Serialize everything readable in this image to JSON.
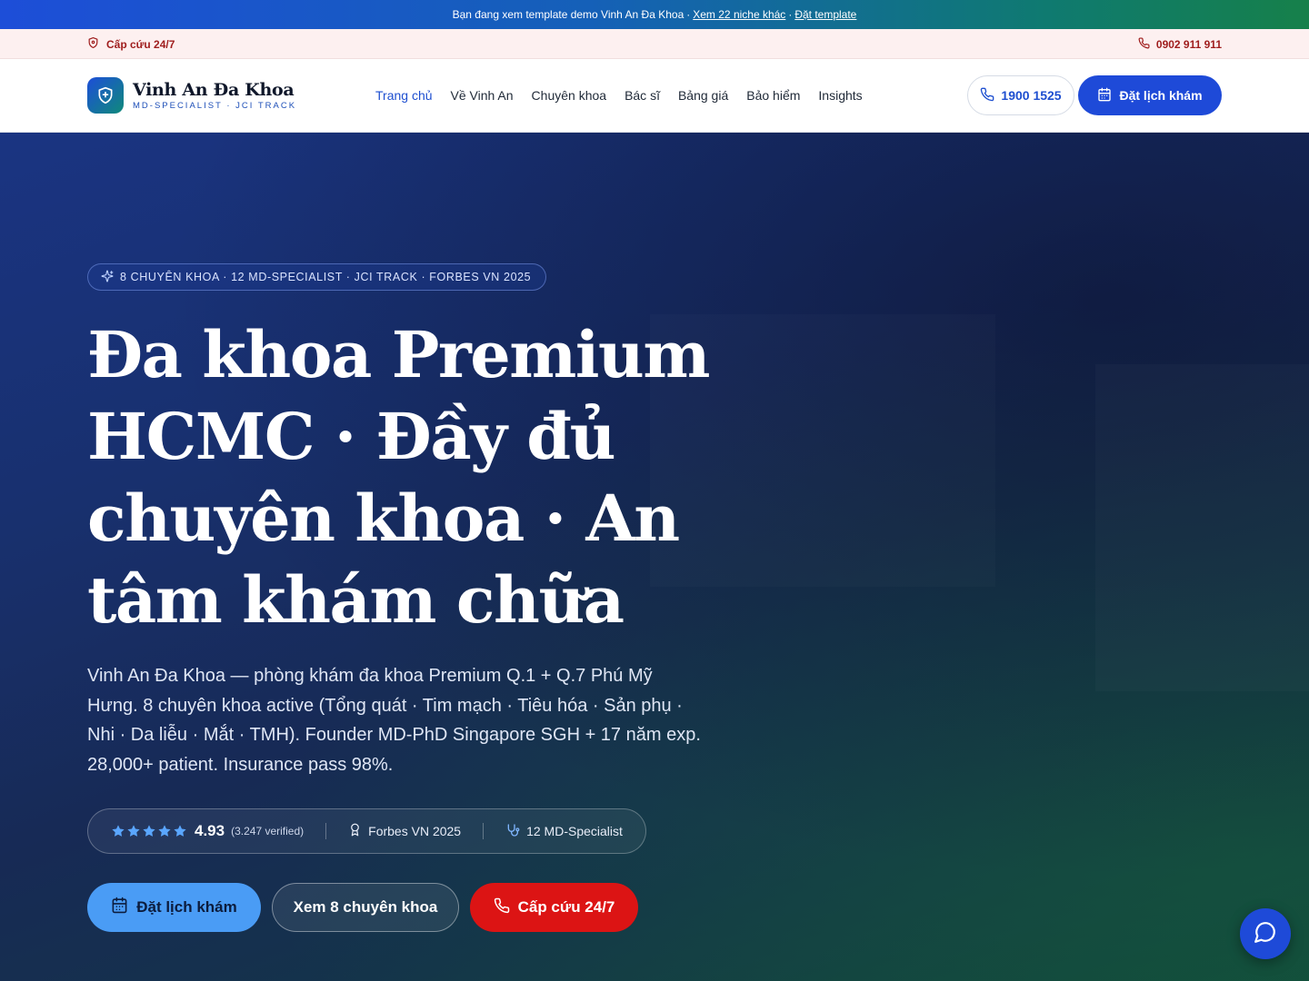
{
  "banner": {
    "text": "Bạn đang xem template demo Vinh An Đa Khoa",
    "sep": "·",
    "link1": "Xem 22 niche khác",
    "link2": "Đặt template"
  },
  "utility": {
    "emergency": "Cấp cứu 24/7",
    "phone": "0902 911 911"
  },
  "header": {
    "logo_title": "Vinh An Đa Khoa",
    "logo_sub": "MD-SPECIALIST · JCI TRACK",
    "nav": [
      "Trang chủ",
      "Về Vinh An",
      "Chuyên khoa",
      "Bác sĩ",
      "Bảng giá",
      "Bảo hiểm",
      "Insights"
    ],
    "hotline": "1900 1525",
    "book_label": "Đặt lịch khám"
  },
  "hero": {
    "pill": "8 CHUYÊN KHOA · 12 MD-SPECIALIST · JCI TRACK · FORBES VN 2025",
    "title": "Đa khoa Premium HCMC · Đầy đủ chuyên khoa · An tâm khám chữa",
    "description": "Vinh An Đa Khoa — phòng khám đa khoa Premium Q.1 + Q.7 Phú Mỹ Hưng. 8 chuyên khoa active (Tổng quát · Tim mạch · Tiêu hóa · Sản phụ · Nhi · Da liễu · Mắt · TMH). Founder MD-PhD Singapore SGH + 17 năm exp. 28,000+ patient. Insurance pass 98%.",
    "rating": "4.93",
    "stars": 5,
    "verified": "(3.247 verified)",
    "award": "Forbes VN 2025",
    "specialists": "12 MD-Specialist",
    "btn_book": "Đặt lịch khám",
    "btn_specialties": "Xem 8 chuyên khoa",
    "btn_emergency": "Cấp cứu 24/7"
  },
  "colors": {
    "primary": "#1e4ad8",
    "emergency": "#dc1414",
    "star": "#4a9cf5"
  }
}
